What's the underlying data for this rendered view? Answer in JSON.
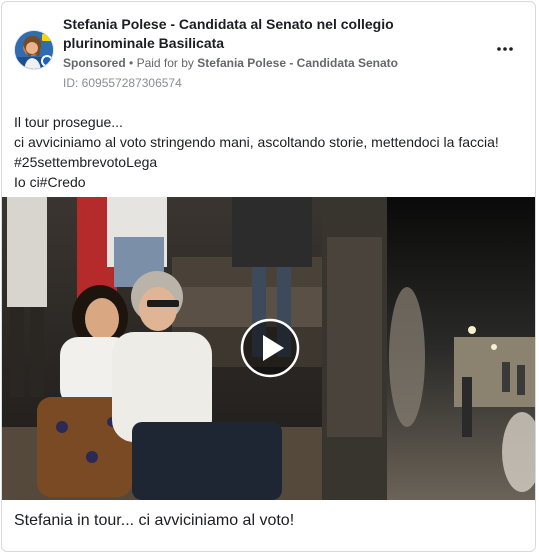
{
  "post": {
    "page_name": "Stefania Polese - Candidata al Senato nel collegio plurinominale Basilicata",
    "sponsored_label": "Sponsored",
    "separator": "•",
    "paid_for_prefix": "Paid for by",
    "advertiser": "Stefania Polese - Candidata Senato",
    "ad_id": "ID: 609557287306574",
    "more_icon": "more-horizontal-icon",
    "body_lines": [
      "Il tour prosegue...",
      "ci avviciniamo al voto stringendo mani, ascoltando storie, mettendoci la faccia!",
      "#25settembrevotoLega",
      "Io ci#Credo"
    ],
    "media": {
      "type": "video",
      "play_icon": "play-icon"
    },
    "caption": "Stefania in tour... ci avviciniamo al voto!"
  },
  "colors": {
    "text_primary": "#1c1e21",
    "text_secondary": "#65676b",
    "border": "#d7d9dd"
  }
}
